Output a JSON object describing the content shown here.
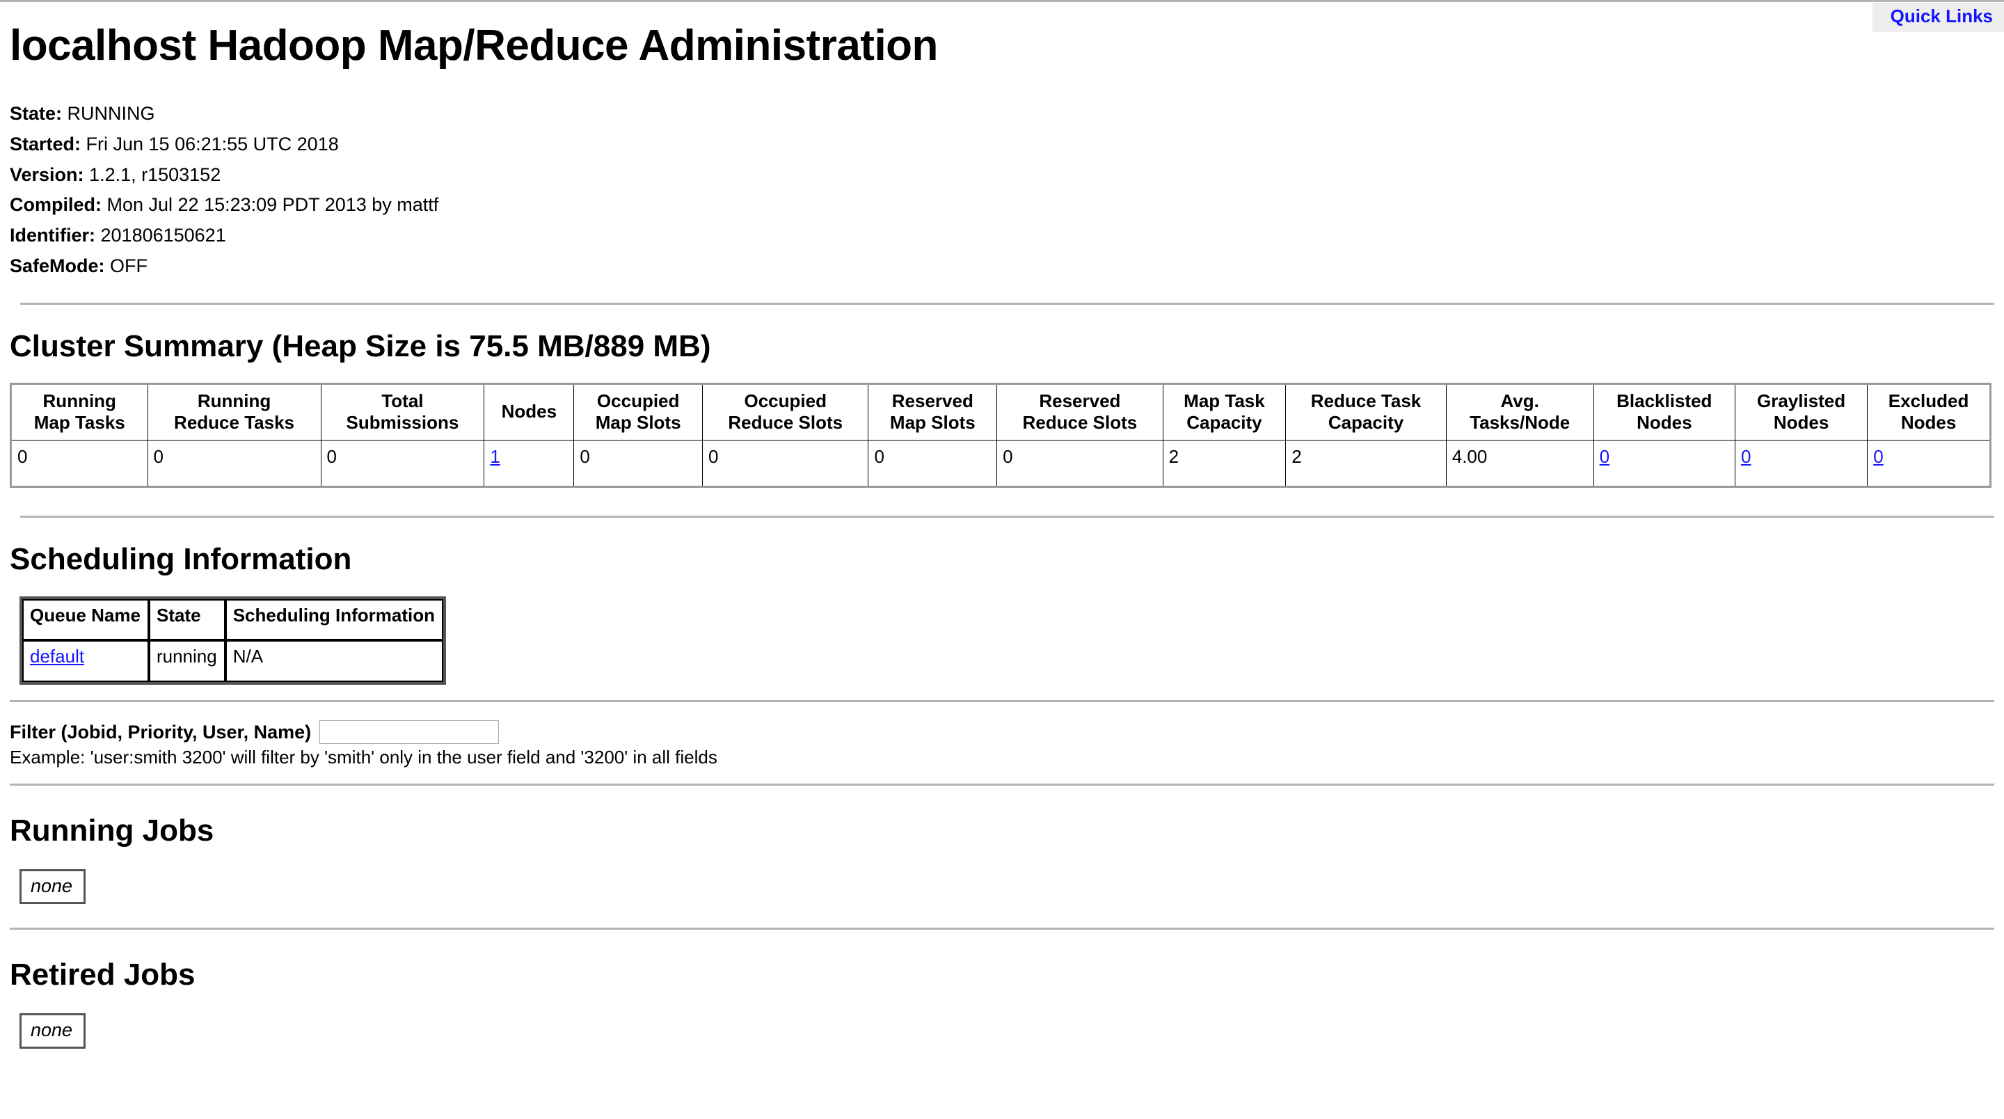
{
  "header": {
    "quick_links_label": "Quick Links",
    "title": "localhost Hadoop Map/Reduce Administration"
  },
  "status": {
    "items": [
      {
        "key": "State:",
        "value": "RUNNING"
      },
      {
        "key": "Started:",
        "value": "Fri Jun 15 06:21:55 UTC 2018"
      },
      {
        "key": "Version:",
        "value": "1.2.1, r1503152"
      },
      {
        "key": "Compiled:",
        "value": "Mon Jul 22 15:23:09 PDT 2013 by mattf"
      },
      {
        "key": "Identifier:",
        "value": "201806150621"
      },
      {
        "key": "SafeMode:",
        "value": "OFF"
      }
    ]
  },
  "cluster_summary": {
    "title": "Cluster Summary (Heap Size is 75.5 MB/889 MB)",
    "columns": [
      "Running\nMap Tasks",
      "Running\nReduce Tasks",
      "Total\nSubmissions",
      "Nodes",
      "Occupied\nMap Slots",
      "Occupied\nReduce Slots",
      "Reserved\nMap Slots",
      "Reserved\nReduce Slots",
      "Map Task\nCapacity",
      "Reduce Task\nCapacity",
      "Avg.\nTasks/Node",
      "Blacklisted\nNodes",
      "Graylisted\nNodes",
      "Excluded\nNodes"
    ],
    "row": [
      {
        "value": "0",
        "link": false
      },
      {
        "value": "0",
        "link": false
      },
      {
        "value": "0",
        "link": false
      },
      {
        "value": "1",
        "link": true
      },
      {
        "value": "0",
        "link": false
      },
      {
        "value": "0",
        "link": false
      },
      {
        "value": "0",
        "link": false
      },
      {
        "value": "0",
        "link": false
      },
      {
        "value": "2",
        "link": false
      },
      {
        "value": "2",
        "link": false
      },
      {
        "value": "4.00",
        "link": false
      },
      {
        "value": "0",
        "link": true
      },
      {
        "value": "0",
        "link": true
      },
      {
        "value": "0",
        "link": true
      }
    ]
  },
  "scheduling": {
    "title": "Scheduling Information",
    "columns": [
      "Queue Name",
      "State",
      "Scheduling Information"
    ],
    "rows": [
      {
        "queue_name": "default",
        "state": "running",
        "info": "N/A"
      }
    ]
  },
  "filter": {
    "label": "Filter (Jobid, Priority, User, Name)",
    "value": "",
    "placeholder": "",
    "example": "Example: 'user:smith 3200' will filter by 'smith' only in the user field and '3200' in all fields"
  },
  "running_jobs": {
    "title": "Running Jobs",
    "empty_label": "none"
  },
  "retired_jobs": {
    "title": "Retired Jobs",
    "empty_label": "none"
  },
  "colors": {
    "link": "#1414ff",
    "rule": "#b5b5b5",
    "quicklinks_bg": "#eeeeee"
  }
}
